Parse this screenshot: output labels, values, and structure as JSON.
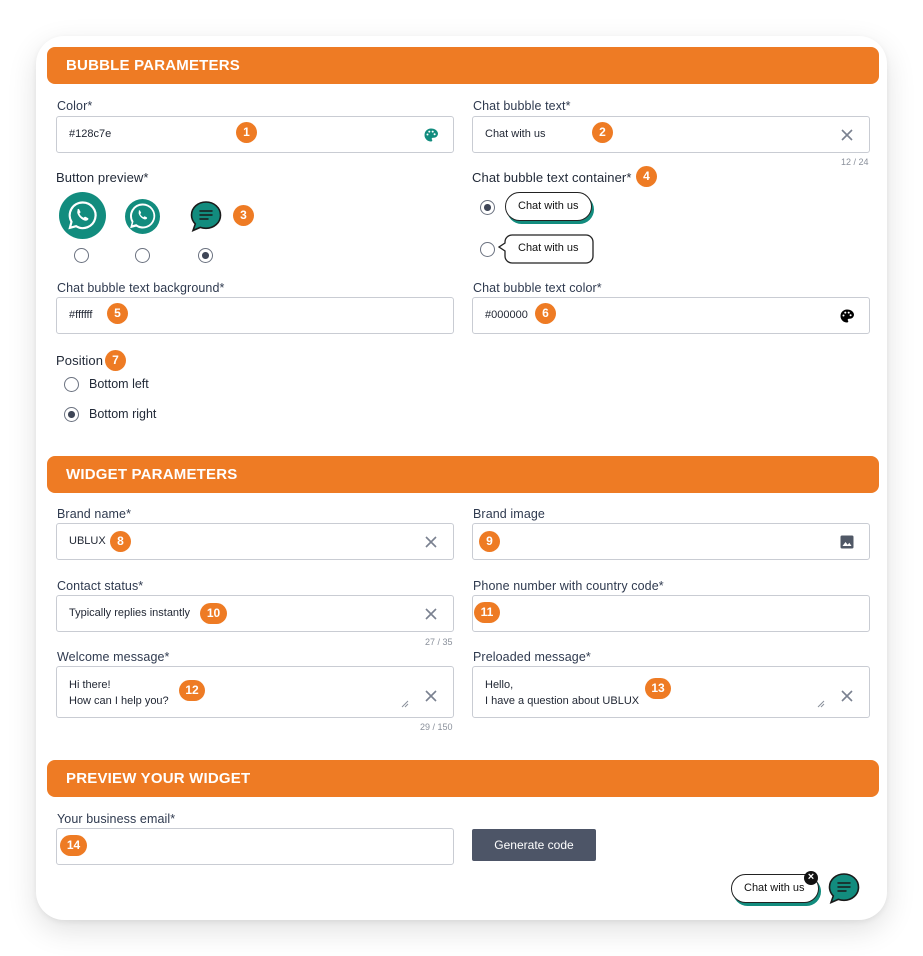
{
  "sections": {
    "bubble": "BUBBLE PARAMETERS",
    "widget": "WIDGET PARAMETERS",
    "preview": "PREVIEW YOUR WIDGET"
  },
  "bubble": {
    "color_label": "Color*",
    "color_value": "#128c7e",
    "text_label": "Chat bubble text*",
    "text_value": "Chat with us",
    "text_counter": "12 / 24",
    "button_preview_label": "Button preview*",
    "container_label": "Chat bubble text container*",
    "container_option1": "Chat with us",
    "container_option2": "Chat with us",
    "bg_label": "Chat bubble text background*",
    "bg_value": "#ffffff",
    "text_color_label": "Chat bubble text color*",
    "text_color_value": "#000000",
    "position_label": "Position",
    "position_left": "Bottom left",
    "position_right": "Bottom right"
  },
  "widget": {
    "brand_name_label": "Brand name*",
    "brand_name_value": "UBLUX",
    "brand_image_label": "Brand image",
    "contact_status_label": "Contact status*",
    "contact_status_value": "Typically replies instantly",
    "contact_status_counter": "27 / 35",
    "phone_label": "Phone number with country code*",
    "welcome_label": "Welcome message*",
    "welcome_value": "Hi there!\nHow can I help you?",
    "welcome_counter": "29 / 150",
    "preloaded_label": "Preloaded message*",
    "preloaded_value": "Hello,\nI have a question about UBLUX"
  },
  "preview": {
    "email_label": "Your business email*",
    "generate_button": "Generate code",
    "floating_bubble_text": "Chat with us",
    "close_glyph": "×"
  },
  "badges": [
    "1",
    "2",
    "3",
    "4",
    "5",
    "6",
    "7",
    "8",
    "9",
    "10",
    "11",
    "12",
    "13",
    "14"
  ],
  "colors": {
    "accent": "#ee7b24",
    "whatsapp_green": "#128c7e",
    "button_dark": "#4d5567"
  },
  "icons": {
    "clear": "close-icon",
    "palette": "palette-icon",
    "image": "image-icon"
  }
}
